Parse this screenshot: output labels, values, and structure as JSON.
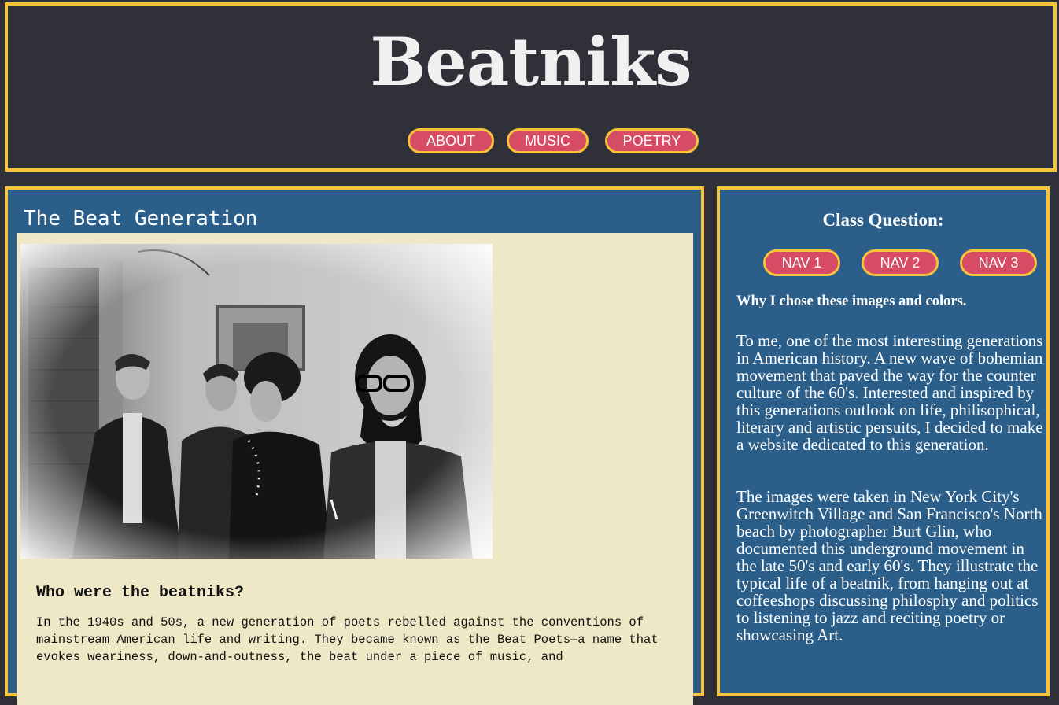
{
  "header": {
    "title": "Beatniks",
    "nav": [
      "ABOUT",
      "MUSIC",
      "POETRY"
    ]
  },
  "main": {
    "heading": "The Beat Generation",
    "subheading": "Who were the beatniks?",
    "body": "In the 1940s and 50s, a new generation of poets rebelled against the conventions of mainstream American life and writing. They became known as the Beat Poets—a name that evokes weariness, down-and-outness, the beat under a piece of music, and"
  },
  "sidebar": {
    "heading": "Class Question:",
    "nav": [
      "NAV 1",
      "NAV 2",
      "NAV 3"
    ],
    "subheading": "Why I chose these images and colors.",
    "paragraph1": "To me, one of the most interesting generations in American history. A new wave of bohemian movement that paved the way for the counter culture of the 60's. Interested and inspired by this generations outlook on life, philisophical, literary and artistic persuits, I decided to make a website dedicated to this generation.",
    "paragraph2": "The images were taken in New York City's Greenwitch Village and San Francisco's North beach by photographer Burt Glin, who documented this underground movement in the late 50's and early 60's. They illustrate the typical life of a beatnik, from hanging out at coffeeshops discussing philosphy and politics to listening to jazz and reciting poetry or showcasing Art."
  },
  "colors": {
    "page_bg": "#2f3038",
    "panel_bg": "#2b5f8a",
    "border": "#f6c33b",
    "button": "#d54c64",
    "content_bg": "#efe8c6"
  }
}
